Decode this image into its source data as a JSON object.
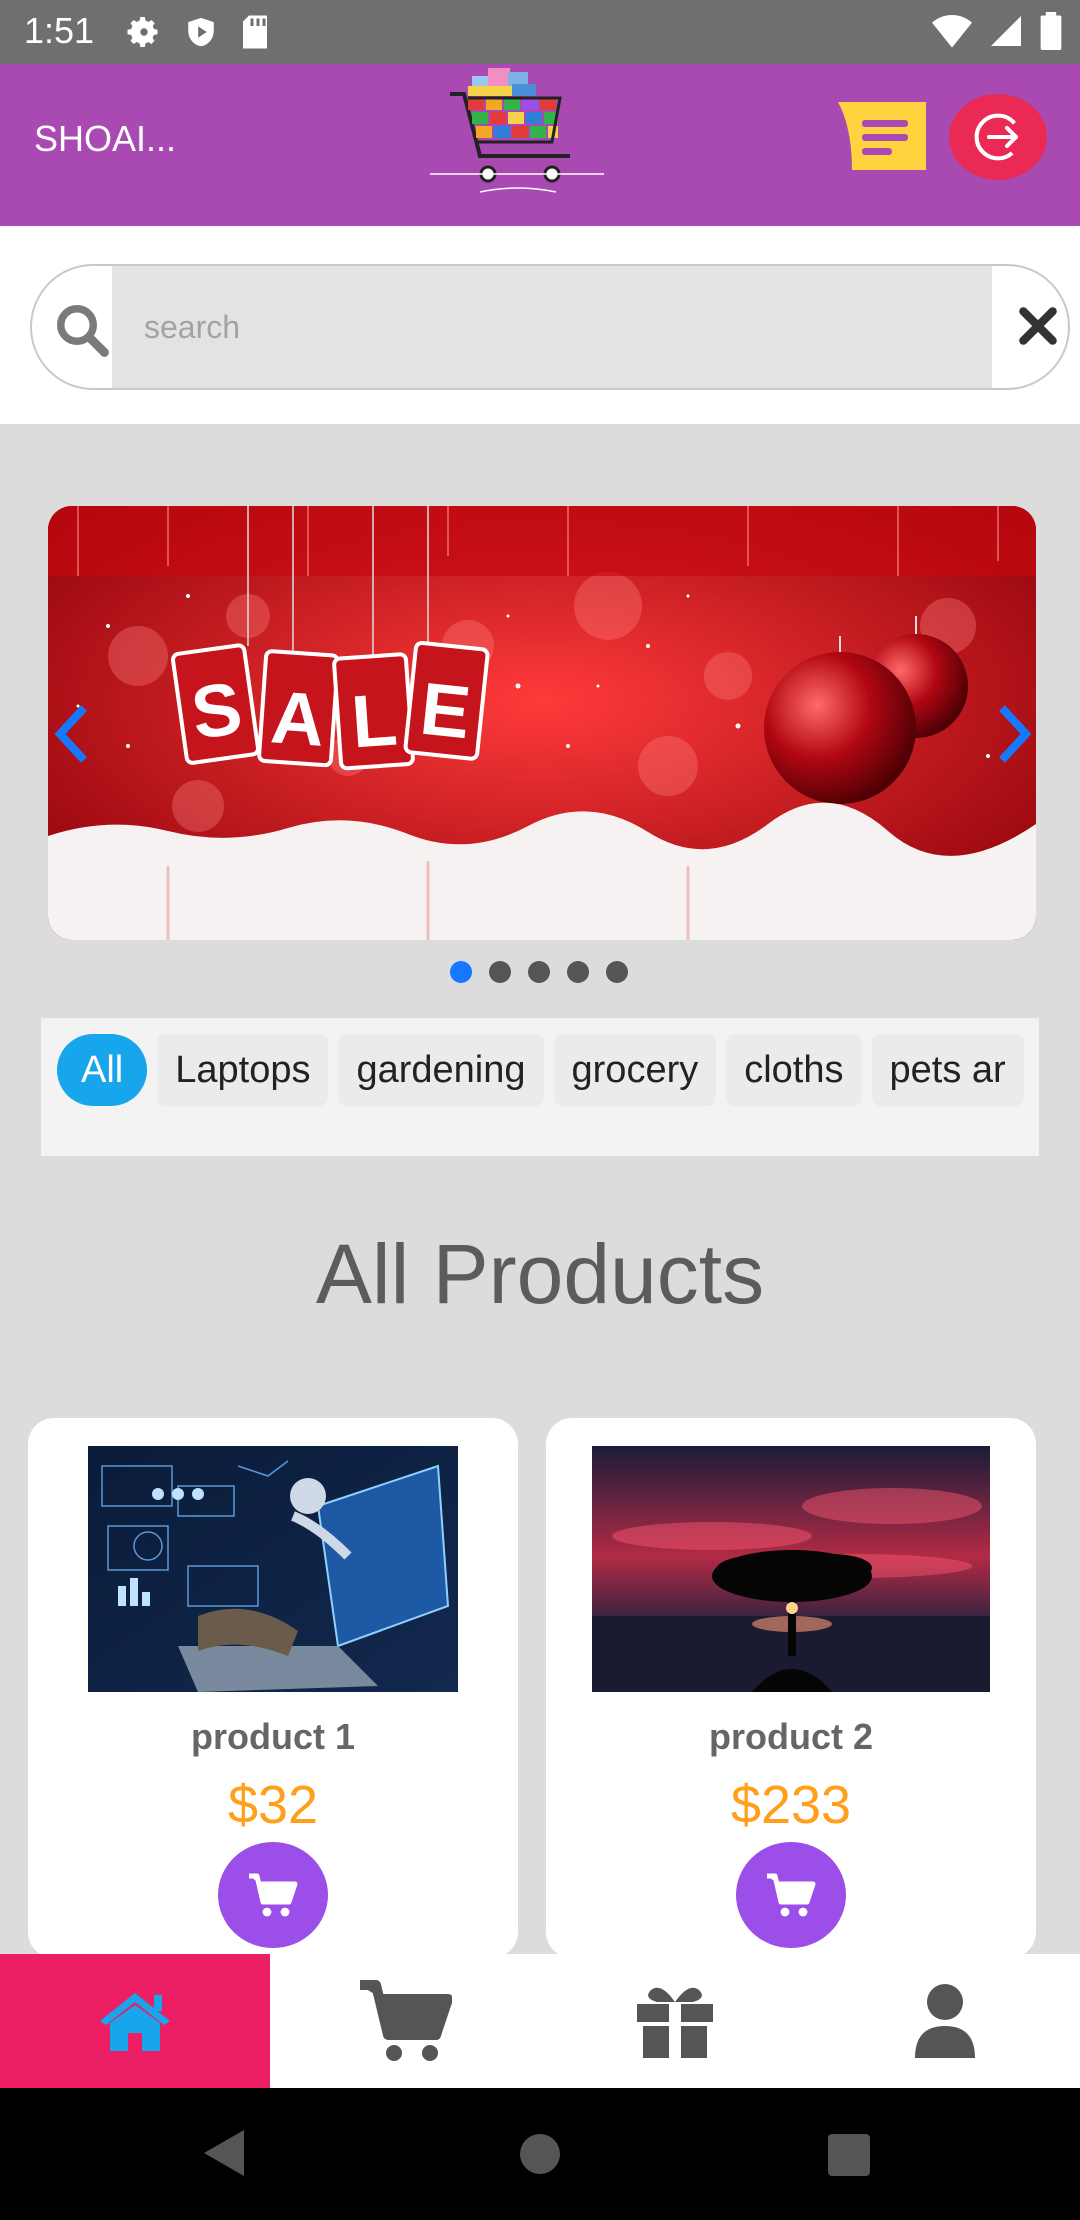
{
  "status_bar": {
    "time": "1:51"
  },
  "app_bar": {
    "user_name": "SHOAI...",
    "colors": {
      "background": "#a94ab3",
      "logout": "#ea2a55",
      "menu": "#ffd23f"
    }
  },
  "search": {
    "placeholder": "search",
    "value": ""
  },
  "banner": {
    "text": "SALE",
    "slides_total": 5,
    "active_slide": 1
  },
  "categories": {
    "items": [
      "All",
      "Laptops",
      "gardening",
      "grocery",
      "cloths",
      "pets ar"
    ],
    "selected": "All"
  },
  "section_title": "All Products",
  "products": [
    {
      "name": "product 1",
      "price": "$32"
    },
    {
      "name": "product 2",
      "price": "$233"
    }
  ],
  "bottom_nav": {
    "items": [
      "home-icon",
      "cart-icon",
      "gift-icon",
      "user-icon"
    ],
    "active": "home-icon",
    "accent": "#ec1f64"
  }
}
